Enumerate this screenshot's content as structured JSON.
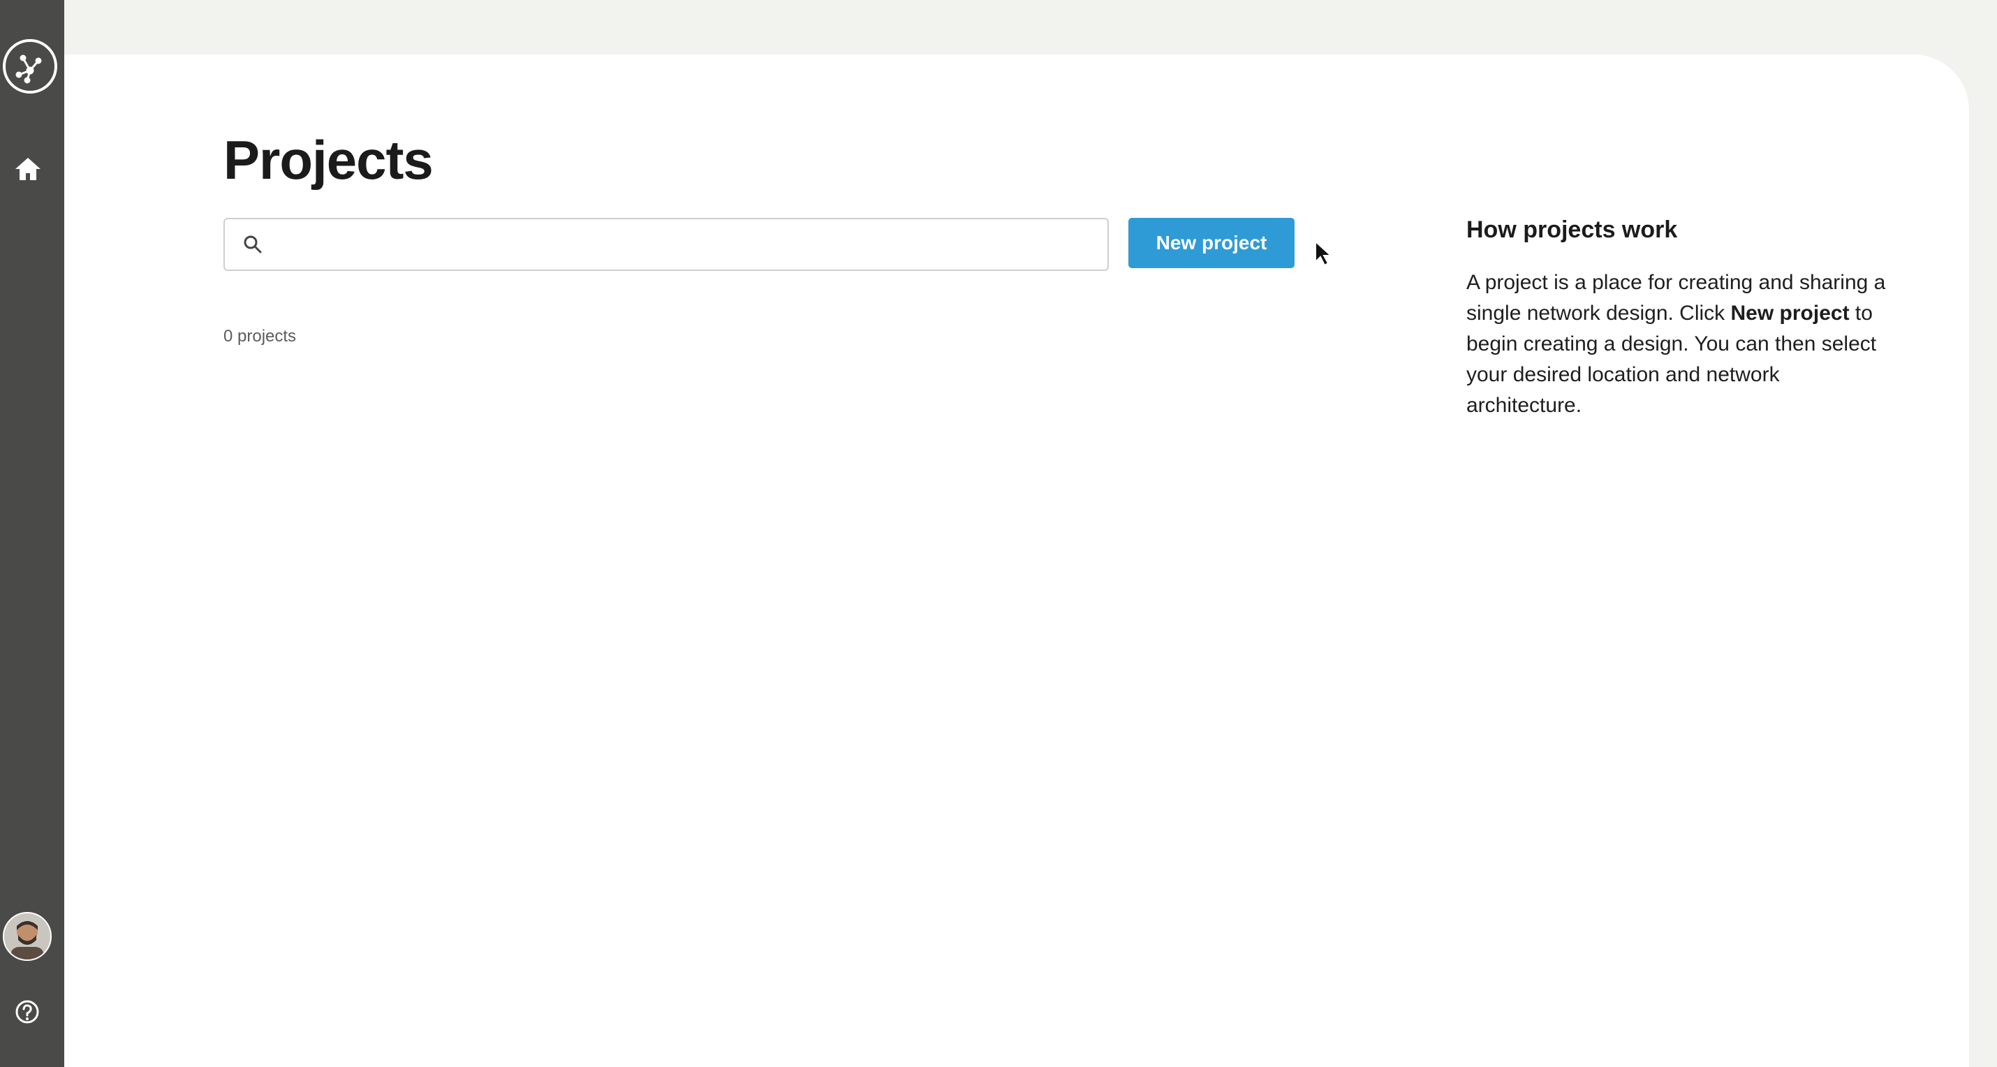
{
  "sidebar": {
    "logo_icon": "network-logo-icon",
    "home_icon": "home-icon",
    "avatar_icon": "user-avatar",
    "help_icon": "help-icon"
  },
  "page": {
    "title": "Projects"
  },
  "search": {
    "value": "",
    "placeholder": ""
  },
  "actions": {
    "new_project_label": "New project"
  },
  "projects": {
    "count_text": "0 projects"
  },
  "help_panel": {
    "heading": "How projects work",
    "text_part1": "A project is a place for creating and sharing a single network design. Click ",
    "text_bold": "New project",
    "text_part2": " to begin creating a design. You can then select your desired location and network architecture."
  },
  "colors": {
    "sidebar": "#4a4a48",
    "accent": "#2f9bd6",
    "background": "#ffffff"
  }
}
